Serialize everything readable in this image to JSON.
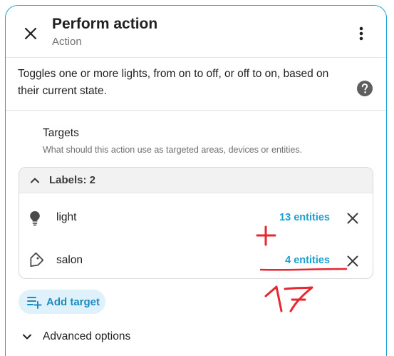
{
  "dialog": {
    "title": "Perform action",
    "subtitle": "Action",
    "description": "Toggles one or more lights, from on to off, or off to on, based on their current state."
  },
  "icons": {
    "close": "close-icon",
    "menu": "more-vertical-icon",
    "help": "help-circle-icon",
    "label": "label-icon",
    "lightbulb": "lightbulb-icon",
    "remove": "close-icon",
    "add": "playlist-plus-icon",
    "chevron": "chevron-down-icon"
  },
  "targets": {
    "title": "Targets",
    "description": "What should this action use as targeted areas, devices or entities.",
    "labels_header": "Labels: 2",
    "items": [
      {
        "name": "light",
        "count": "13 entities",
        "icon": "lightbulb-icon"
      },
      {
        "name": "salon",
        "count": "4 entities",
        "icon": "label-icon"
      }
    ],
    "add_label": "Add target"
  },
  "advanced": {
    "label": "Advanced options"
  },
  "annotation": {
    "plus": "+",
    "total": "17",
    "color": "#e8262f"
  },
  "colors": {
    "accent": "#1d9fd3",
    "border": "#1fa2d8",
    "chip_bg": "#dff1fa"
  }
}
